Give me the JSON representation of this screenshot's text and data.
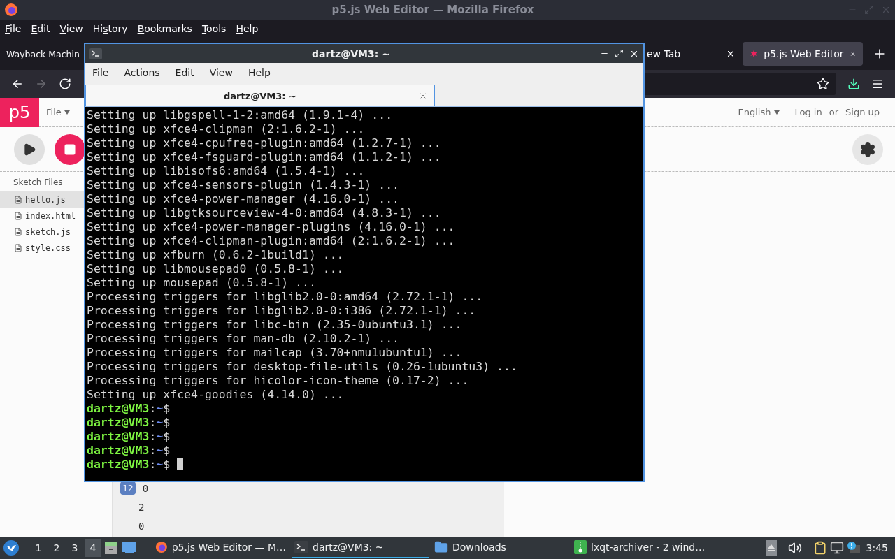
{
  "firefox": {
    "title": "p5.js Web Editor — Mozilla Firefox",
    "menu": [
      {
        "key": "F",
        "post": "ile"
      },
      {
        "key": "E",
        "post": "dit"
      },
      {
        "key": "V",
        "post": "iew"
      },
      {
        "pre": "Hi",
        "key": "s",
        "post": "tory"
      },
      {
        "key": "B",
        "post": "ookmarks"
      },
      {
        "key": "T",
        "post": "ools"
      },
      {
        "key": "H",
        "post": "elp"
      }
    ],
    "tabs": [
      {
        "label": "Wayback Machin",
        "selected": false,
        "closable": false,
        "favicon": false
      },
      {
        "label": "ew Tab",
        "selected": false,
        "closable": true,
        "favicon": false
      },
      {
        "label": "p5.js Web Editor",
        "selected": true,
        "closable": true,
        "favicon": true
      }
    ],
    "nav": {
      "back_disabled": false,
      "forward_disabled": true,
      "download_active": true
    }
  },
  "p5": {
    "logo": "p5",
    "file_menu": "File",
    "language": "English",
    "login": "Log in",
    "or": "or",
    "signup": "Sign up",
    "sidebar_title": "Sketch Files",
    "files": [
      {
        "name": "hello.js",
        "selected": true
      },
      {
        "name": "index.html",
        "selected": false
      },
      {
        "name": "sketch.js",
        "selected": false
      },
      {
        "name": "style.css",
        "selected": false
      }
    ],
    "editor_rows": [
      {
        "badge": "12",
        "text": "0"
      },
      {
        "text": "2"
      },
      {
        "text": "0"
      }
    ]
  },
  "terminal": {
    "title": "dartz@VM3: ~",
    "menu": [
      "File",
      "Actions",
      "Edit",
      "View",
      "Help"
    ],
    "tab": "dartz@VM3: ~",
    "lines": [
      {
        "kind": "output",
        "text": "Setting up libgspell-1-2:amd64 (1.9.1-4) ..."
      },
      {
        "kind": "output",
        "text": "Setting up xfce4-clipman (2:1.6.2-1) ..."
      },
      {
        "kind": "output",
        "text": "Setting up xfce4-cpufreq-plugin:amd64 (1.2.7-1) ..."
      },
      {
        "kind": "output",
        "text": "Setting up xfce4-fsguard-plugin:amd64 (1.1.2-1) ..."
      },
      {
        "kind": "output",
        "text": "Setting up libisofs6:amd64 (1.5.4-1) ..."
      },
      {
        "kind": "output",
        "text": "Setting up xfce4-sensors-plugin (1.4.3-1) ..."
      },
      {
        "kind": "output",
        "text": "Setting up xfce4-power-manager (4.16.0-1) ..."
      },
      {
        "kind": "output",
        "text": "Setting up libgtksourceview-4-0:amd64 (4.8.3-1) ..."
      },
      {
        "kind": "output",
        "text": "Setting up xfce4-power-manager-plugins (4.16.0-1) ..."
      },
      {
        "kind": "output",
        "text": "Setting up xfce4-clipman-plugin:amd64 (2:1.6.2-1) ..."
      },
      {
        "kind": "output",
        "text": "Setting up xfburn (0.6.2-1build1) ..."
      },
      {
        "kind": "output",
        "text": "Setting up libmousepad0 (0.5.8-1) ..."
      },
      {
        "kind": "output",
        "text": "Setting up mousepad (0.5.8-1) ..."
      },
      {
        "kind": "output",
        "text": "Processing triggers for libglib2.0-0:amd64 (2.72.1-1) ..."
      },
      {
        "kind": "output",
        "text": "Processing triggers for libglib2.0-0:i386 (2.72.1-1) ..."
      },
      {
        "kind": "output",
        "text": "Processing triggers for libc-bin (2.35-0ubuntu3.1) ..."
      },
      {
        "kind": "output",
        "text": "Processing triggers for man-db (2.10.2-1) ..."
      },
      {
        "kind": "output",
        "text": "Processing triggers for mailcap (3.70+nmu1ubuntu1) ..."
      },
      {
        "kind": "output",
        "text": "Processing triggers for desktop-file-utils (0.26-1ubuntu3) ..."
      },
      {
        "kind": "output",
        "text": "Processing triggers for hicolor-icon-theme (0.17-2) ..."
      },
      {
        "kind": "output",
        "text": "Setting up xfce4-goodies (4.14.0) ..."
      },
      {
        "kind": "prompt",
        "user": "dartz@VM3",
        "sep": ":",
        "path": "~",
        "symbol": "$",
        "cursor": false
      },
      {
        "kind": "prompt",
        "user": "dartz@VM3",
        "sep": ":",
        "path": "~",
        "symbol": "$",
        "cursor": false
      },
      {
        "kind": "prompt",
        "user": "dartz@VM3",
        "sep": ":",
        "path": "~",
        "symbol": "$",
        "cursor": false
      },
      {
        "kind": "prompt",
        "user": "dartz@VM3",
        "sep": ":",
        "path": "~",
        "symbol": "$",
        "cursor": false
      },
      {
        "kind": "prompt",
        "user": "dartz@VM3",
        "sep": ":",
        "path": "~",
        "symbol": "$",
        "cursor": true
      }
    ]
  },
  "taskbar": {
    "workspaces": [
      {
        "label": "1",
        "selected": false
      },
      {
        "label": "2",
        "selected": false
      },
      {
        "label": "3",
        "selected": false
      },
      {
        "label": "4",
        "selected": true
      }
    ],
    "tasks": [
      {
        "kind": "firefox",
        "label": "p5.js Web Editor — M…",
        "active": false
      },
      {
        "kind": "terminal",
        "label": "dartz@VM3: ~",
        "active": true
      },
      {
        "kind": "folder",
        "label": "Downloads",
        "active": false
      },
      {
        "kind": "archive",
        "label": "lxqt-archiver - 2 wind…",
        "active": false
      }
    ],
    "clock": "3:45"
  }
}
